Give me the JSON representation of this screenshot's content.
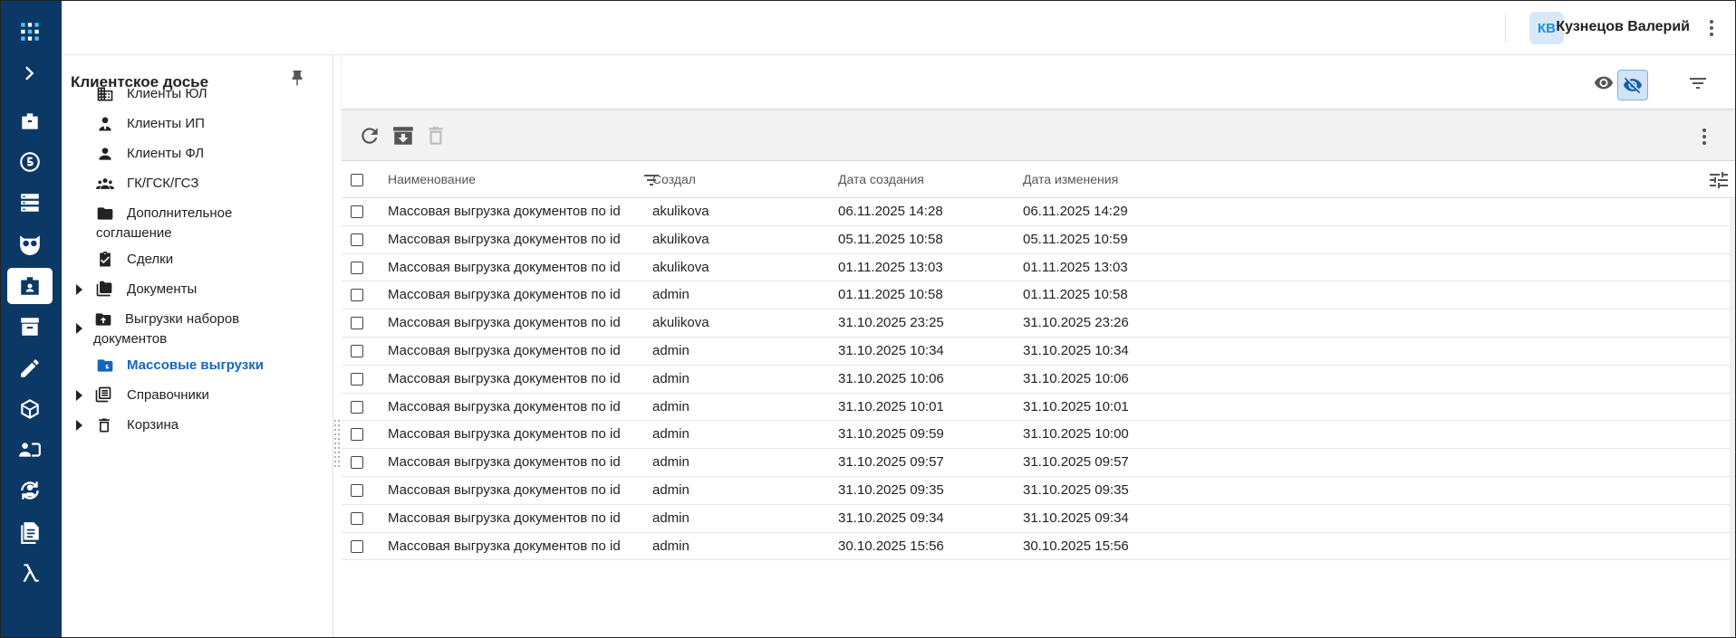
{
  "topbar": {
    "avatar_initials": "КВ",
    "user_name": "Кузнецов Валерий"
  },
  "rail": {
    "items": [
      "apps-icon",
      "expand-icon",
      "briefcase-icon",
      "counter-5-icon",
      "servers-icon",
      "owl-icon",
      "client-card-icon",
      "archive-icon",
      "edit-icon",
      "cube-icon",
      "person-id-icon",
      "sync-person-icon",
      "documents-icon",
      "lambda-icon"
    ],
    "active": "client-card-icon"
  },
  "sidebar": {
    "title": "Клиентское досье",
    "items": [
      {
        "label": "Клиенты ЮЛ",
        "icon": "building-icon"
      },
      {
        "label": "Клиенты ИП",
        "icon": "person-tie-icon"
      },
      {
        "label": "Клиенты ФЛ",
        "icon": "person-icon"
      },
      {
        "label": "ГК/ГСК/ГСЗ",
        "icon": "group-icon"
      },
      {
        "label": "Дополнительное",
        "label2": "соглашение",
        "icon": "folder-icon"
      },
      {
        "label": "Сделки",
        "icon": "clipboard-check-icon"
      },
      {
        "label": "Документы",
        "icon": "folders-icon",
        "expandable": true
      },
      {
        "label": "Выгрузки наборов",
        "label2": "документов",
        "icon": "folder-upload-icon",
        "expandable": true
      },
      {
        "label": "Массовые выгрузки",
        "icon": "folder-blue-icon",
        "selected": true
      },
      {
        "label": "Справочники",
        "icon": "book-list-icon",
        "expandable": true
      },
      {
        "label": "Корзина",
        "icon": "trash-icon",
        "expandable": true
      }
    ]
  },
  "table": {
    "columns": [
      "Наименование",
      "Создал",
      "Дата создания",
      "Дата изменения"
    ],
    "rows": [
      [
        "Массовая выгрузка документов по id",
        "akulikova",
        "06.11.2025 14:28",
        "06.11.2025 14:29"
      ],
      [
        "Массовая выгрузка документов по id",
        "akulikova",
        "05.11.2025 10:58",
        "05.11.2025 10:59"
      ],
      [
        "Массовая выгрузка документов по id",
        "akulikova",
        "01.11.2025 13:03",
        "01.11.2025 13:03"
      ],
      [
        "Массовая выгрузка документов по id",
        "admin",
        "01.11.2025 10:58",
        "01.11.2025 10:58"
      ],
      [
        "Массовая выгрузка документов по id",
        "akulikova",
        "31.10.2025 23:25",
        "31.10.2025 23:26"
      ],
      [
        "Массовая выгрузка документов по id",
        "admin",
        "31.10.2025 10:34",
        "31.10.2025 10:34"
      ],
      [
        "Массовая выгрузка документов по id",
        "admin",
        "31.10.2025 10:06",
        "31.10.2025 10:06"
      ],
      [
        "Массовая выгрузка документов по id",
        "admin",
        "31.10.2025 10:01",
        "31.10.2025 10:01"
      ],
      [
        "Массовая выгрузка документов по id",
        "admin",
        "31.10.2025 09:59",
        "31.10.2025 10:00"
      ],
      [
        "Массовая выгрузка документов по id",
        "admin",
        "31.10.2025 09:57",
        "31.10.2025 09:57"
      ],
      [
        "Массовая выгрузка документов по id",
        "admin",
        "31.10.2025 09:35",
        "31.10.2025 09:35"
      ],
      [
        "Массовая выгрузка документов по id",
        "admin",
        "31.10.2025 09:34",
        "31.10.2025 09:34"
      ],
      [
        "Массовая выгрузка документов по id",
        "admin",
        "30.10.2025 15:56",
        "30.10.2025 15:56"
      ]
    ]
  },
  "colors": {
    "rail_bg": "#0c3866",
    "accent": "#1565c0",
    "avatar_bg": "#d7e9f9"
  }
}
